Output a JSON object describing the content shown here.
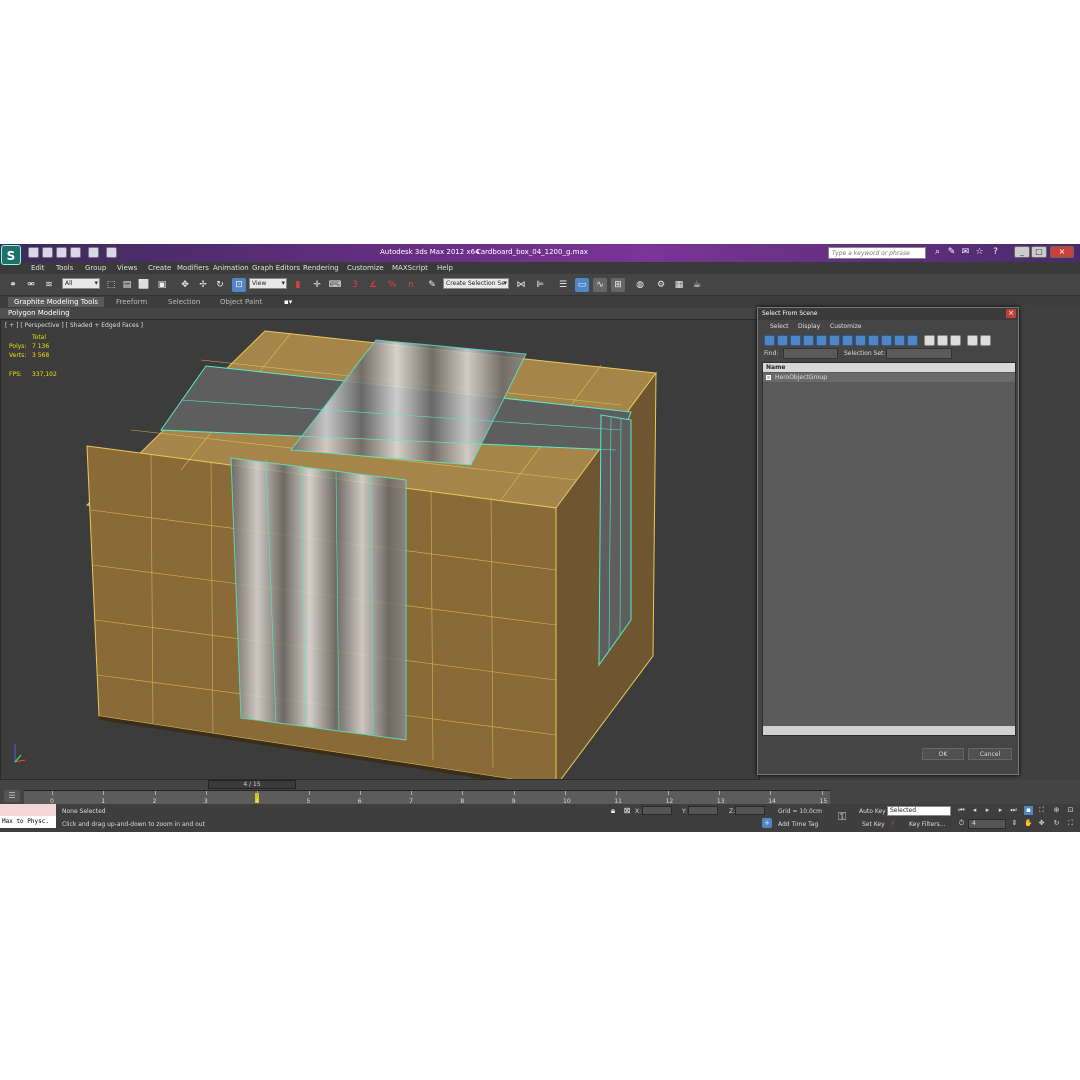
{
  "window": {
    "title": "Autodesk 3ds Max  2012 x64",
    "file": "Cardboard_box_04_1200_g.max",
    "search_placeholder": "Type a keyword or phrase"
  },
  "menu": [
    "Edit",
    "Tools",
    "Group",
    "Views",
    "Create",
    "Modifiers",
    "Animation",
    "Graph Editors",
    "Rendering",
    "Customize",
    "MAXScript",
    "Help"
  ],
  "toolbar": {
    "filter_value": "All",
    "refcoord_value": "View",
    "snap_labels": [
      "3",
      "%",
      "n"
    ],
    "selection_set_value": "Create Selection Se"
  },
  "ribbon": {
    "tabs": [
      "Graphite Modeling Tools",
      "Freeform",
      "Selection",
      "Object Paint"
    ],
    "sub": "Polygon Modeling"
  },
  "viewport": {
    "label": "[ + ] [ Perspective ] [ Shaded + Edged Faces ]",
    "stats_total": "Total",
    "polys_label": "Polys:",
    "polys_value": "7 136",
    "verts_label": "Verts:",
    "verts_value": "3 568",
    "fps_label": "FPS:",
    "fps_value": "337,102"
  },
  "dialog": {
    "title": "Select From Scene",
    "menu": [
      "Select",
      "Display",
      "Customize"
    ],
    "find_label": "Find:",
    "selection_set_label": "Selection Set:",
    "column_name": "Name",
    "rows": [
      "HeroObjectGroup"
    ],
    "ok": "OK",
    "cancel": "Cancel"
  },
  "timeline": {
    "frame_display": "4 / 15",
    "ticks": [
      "0",
      "1",
      "2",
      "3",
      "4",
      "5",
      "6",
      "7",
      "8",
      "9",
      "10",
      "11",
      "12",
      "13",
      "14",
      "15"
    ],
    "current_frame": 4,
    "total_frames": 15
  },
  "status": {
    "maxscript": "Max to Physc.",
    "selection": "None Selected",
    "hint": "Click and drag up-and-down to zoom in and out",
    "x_label": "X:",
    "y_label": "Y:",
    "z_label": "Z:",
    "grid": "Grid = 10,0cm",
    "add_time_tag": "Add Time Tag",
    "auto_key": "Auto Key",
    "set_key": "Set Key",
    "selected_value": "Selected",
    "key_filters": "Key Filters...",
    "frame_value": "4"
  },
  "colors": {
    "title_bar": "#6a2f86",
    "wire_object": "#e8c95a",
    "wire_selected": "#58e8c8",
    "stat_text": "#f0e000"
  }
}
